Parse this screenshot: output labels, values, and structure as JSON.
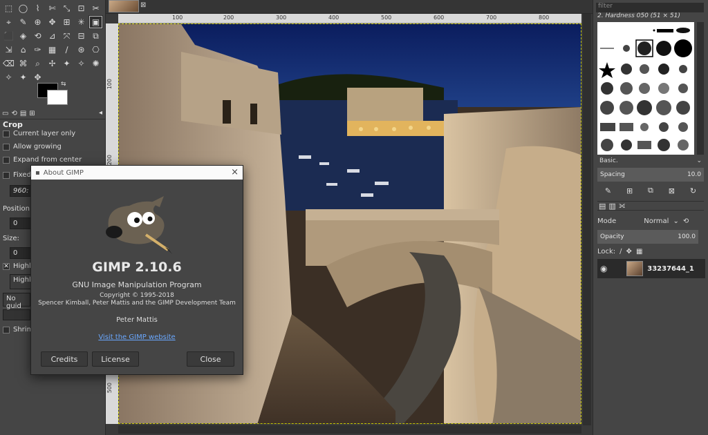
{
  "toolbox": {
    "tools": [
      "⬚",
      "◯",
      "⌇",
      "✄",
      "⤡",
      "⊡",
      "✂",
      "⌖",
      "✎",
      "⊕",
      "✥",
      "⊞",
      "✳",
      "▣",
      "⬛",
      "◈",
      "⟲",
      "⊿",
      "⤧",
      "⊟",
      "⧉",
      "⇲",
      "⌂",
      "✑",
      "▦",
      "∕",
      "⊛",
      "⎔",
      "⌫",
      "⌘",
      "⌕",
      "✢",
      "✦",
      "✧",
      "✺",
      "✧",
      "✦",
      "✥"
    ],
    "options_tab_icons": [
      "▭",
      "⟲",
      "▤",
      "⊞"
    ],
    "options_title": "Crop",
    "current_layer_only": "Current layer only",
    "allow_growing": "Allow growing",
    "expand_from_center": "Expand from center",
    "fixed_label": "Fixed",
    "fixed_value": "960:",
    "position_label": "Position:",
    "position_value": "0",
    "size_label": "Size:",
    "size_value": "0",
    "highlight_label": "Highli",
    "highlight_dropdown": "Highli",
    "guides_dropdown": "No guid",
    "shrink_label": "Shrink"
  },
  "canvas": {
    "ruler_top": [
      "100",
      "200",
      "300",
      "400",
      "500",
      "600",
      "700",
      "800"
    ],
    "ruler_left": [
      "100",
      "200",
      "300",
      "400",
      "500"
    ]
  },
  "about": {
    "window_title": "About GIMP",
    "app_name": "GIMP 2.10.6",
    "subtitle": "GNU Image Manipulation Program",
    "copyright": "Copyright © 1995-2018",
    "authors": "Spencer Kimball, Peter Mattis and the GIMP Development Team",
    "featured_author": "Peter Mattis",
    "website_link": "Visit the GIMP website",
    "credits_button": "Credits",
    "license_button": "License",
    "close_button": "Close"
  },
  "dock": {
    "filter_placeholder": "filter",
    "brush_title": "2. Hardness 050 (51 × 51)",
    "brush_preset": "Basic.",
    "spacing_label": "Spacing",
    "spacing_value": "10.0",
    "mode_label": "Mode",
    "mode_value": "Normal",
    "opacity_label": "Opacity",
    "opacity_value": "100.0",
    "lock_label": "Lock:",
    "layer_name": "33237644_1",
    "brush_icons": [
      "✎",
      "⊞",
      "⧉",
      "⊠",
      "↻"
    ]
  }
}
